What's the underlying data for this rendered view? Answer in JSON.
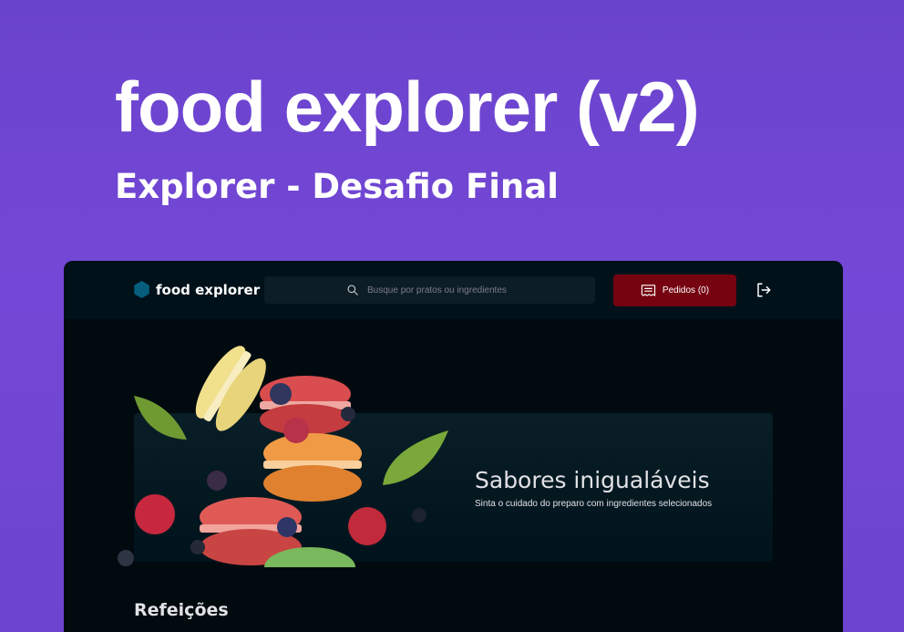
{
  "banner": {
    "title": "food explorer (v2)",
    "subtitle": "Explorer - Desafio Final"
  },
  "header": {
    "logo_text": "food explorer",
    "logo_icon": "hexagon-icon",
    "search_placeholder": "Busque por pratos ou ingredientes",
    "orders_label": "Pedidos (0)",
    "orders_icon": "receipt-icon",
    "logout_icon": "sign-out-icon"
  },
  "hero": {
    "title": "Sabores inigualáveis",
    "subtitle": "Sinta o cuidado do preparo com ingredientes selecionados",
    "image": "macarons-illustration"
  },
  "sections": [
    {
      "title": "Refeições"
    }
  ],
  "colors": {
    "background_purple": "#7448d6",
    "app_background": "#000a0f",
    "header_background": "#00111a",
    "accent_teal": "#065e7c",
    "button_red": "#750310",
    "text_light": "#e1e1e6"
  }
}
